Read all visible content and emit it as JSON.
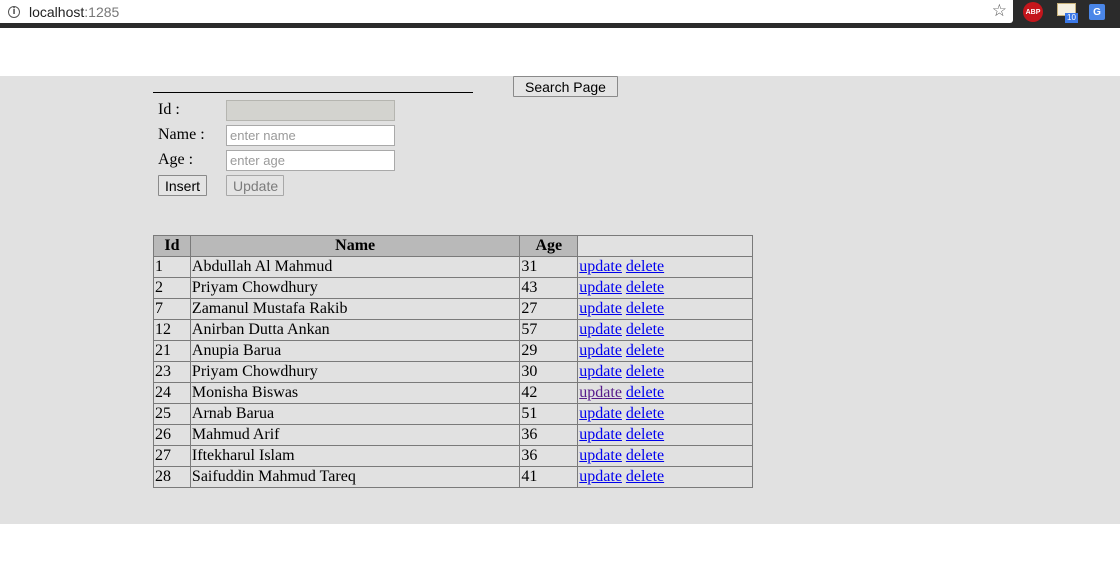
{
  "browser": {
    "url_host": "localhost",
    "url_port": ":1285",
    "abp_label": "ABP",
    "mail_badge": "10",
    "translate_label": "G"
  },
  "form": {
    "search_button": "Search Page",
    "id_label": "Id :",
    "name_label": "Name :",
    "age_label": "Age :",
    "id_value": "",
    "name_placeholder": "enter name",
    "age_placeholder": "enter age",
    "insert_button": "Insert",
    "update_button": "Update"
  },
  "table": {
    "headers": [
      "Id",
      "Name",
      "Age",
      ""
    ],
    "action_update": "update",
    "action_delete": "delete",
    "rows": [
      {
        "id": "1",
        "name": "Abdullah Al Mahmud",
        "age": "31"
      },
      {
        "id": "2",
        "name": "Priyam Chowdhury",
        "age": "43"
      },
      {
        "id": "7",
        "name": "Zamanul Mustafa Rakib",
        "age": "27"
      },
      {
        "id": "12",
        "name": "Anirban Dutta Ankan",
        "age": "57"
      },
      {
        "id": "21",
        "name": "Anupia Barua",
        "age": "29"
      },
      {
        "id": "23",
        "name": "Priyam Chowdhury",
        "age": "30"
      },
      {
        "id": "24",
        "name": "Monisha Biswas",
        "age": "42"
      },
      {
        "id": "25",
        "name": "Arnab Barua",
        "age": "51"
      },
      {
        "id": "26",
        "name": "Mahmud Arif",
        "age": "36"
      },
      {
        "id": "27",
        "name": "Iftekharul Islam",
        "age": "36"
      },
      {
        "id": "28",
        "name": "Saifuddin Mahmud Tareq",
        "age": "41"
      }
    ]
  }
}
